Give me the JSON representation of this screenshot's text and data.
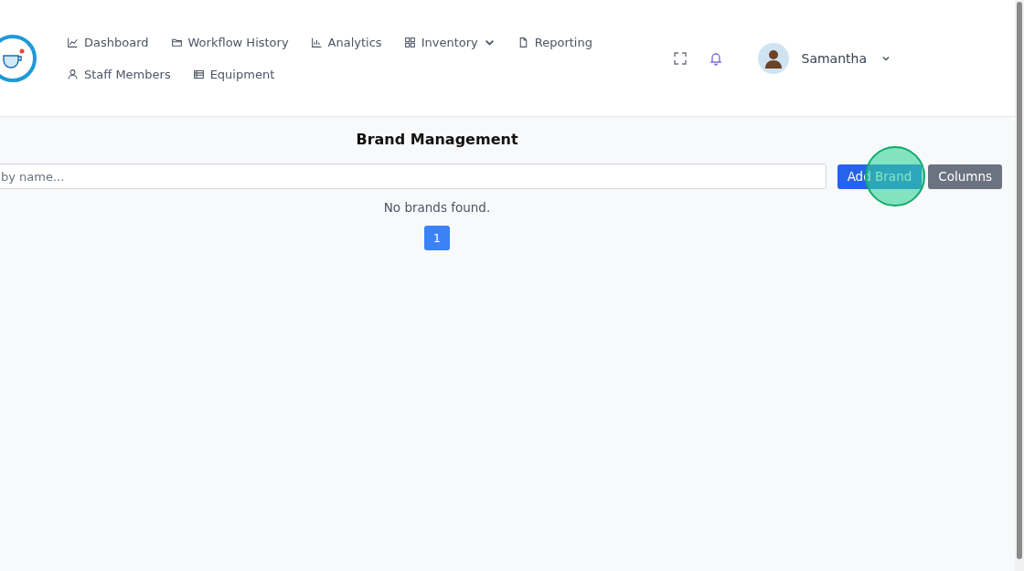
{
  "header": {
    "nav": [
      {
        "label": "Dashboard",
        "dropdown": false
      },
      {
        "label": "Workflow History",
        "dropdown": false
      },
      {
        "label": "Analytics",
        "dropdown": false
      },
      {
        "label": "Inventory",
        "dropdown": true
      },
      {
        "label": "Reporting",
        "dropdown": false
      },
      {
        "label": "Staff Members",
        "dropdown": false
      },
      {
        "label": "Equipment",
        "dropdown": false
      }
    ],
    "user": {
      "name": "Samantha"
    }
  },
  "page": {
    "title": "Brand Management",
    "search": {
      "placeholder": "by name..."
    },
    "buttons": [
      {
        "label": "Add Brand",
        "kind": "primary"
      },
      {
        "label": "Columns",
        "kind": "secondary"
      }
    ],
    "empty_message": "No brands found.",
    "pages": [
      {
        "label": "1",
        "selected": true
      }
    ]
  }
}
